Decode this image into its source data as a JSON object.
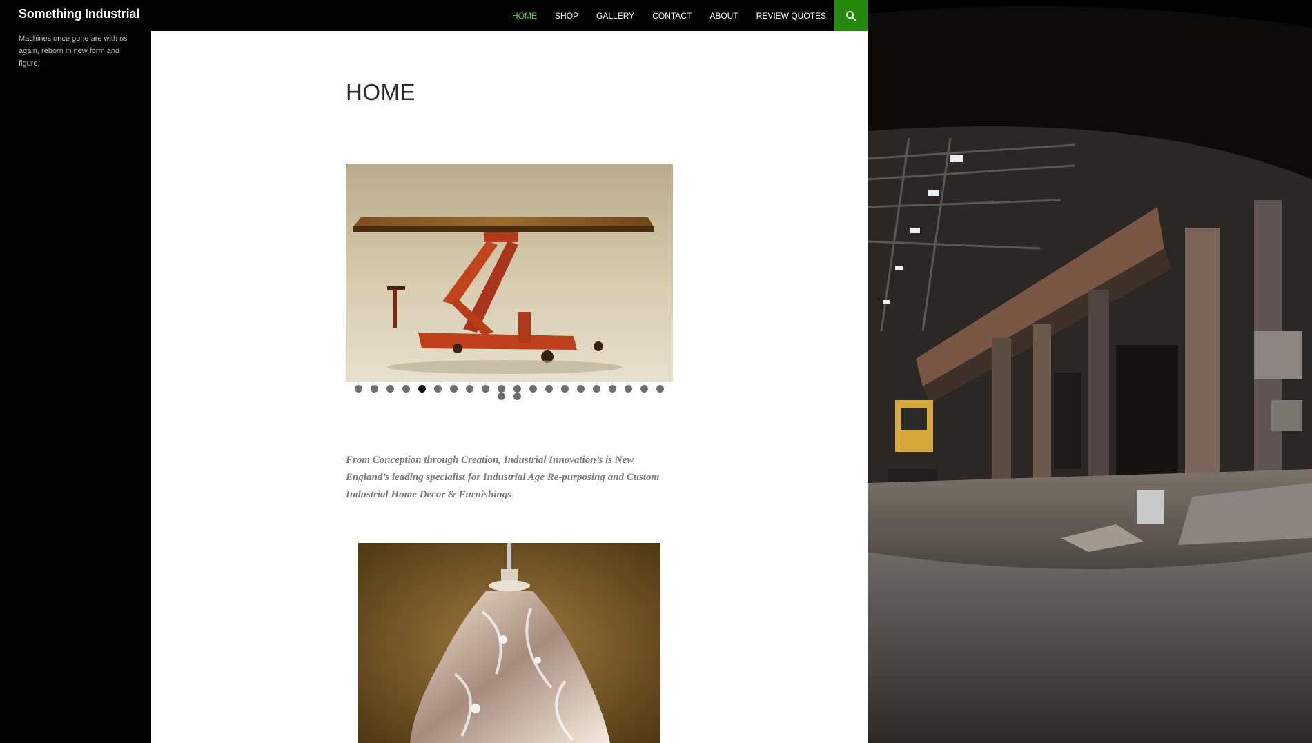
{
  "site": {
    "title": "Something Industrial",
    "description": "Machines once gone are with us again, reborn in new form and figure."
  },
  "nav": {
    "items": [
      {
        "label": "HOME",
        "current": true
      },
      {
        "label": "SHOP",
        "current": false
      },
      {
        "label": "GALLERY",
        "current": false
      },
      {
        "label": "CONTACT",
        "current": false
      },
      {
        "label": "ABOUT",
        "current": false
      },
      {
        "label": "REVIEW QUOTES",
        "current": false
      }
    ],
    "search_icon": "search-icon"
  },
  "page": {
    "title": "HOME",
    "tagline": "From Conception through Creation, Industrial Innovation’s is New England’s leading specialist for Industrial Age Re-purposing and Custom Industrial Home Decor & Furnishings"
  },
  "slider": {
    "total_slides": 22,
    "active_slide": 5,
    "image": "wood-top table on red industrial lift cart"
  },
  "images": {
    "second": "crystal glass pendant lamp",
    "background": "abandoned factory hall interior"
  },
  "colors": {
    "accent": "#24890d",
    "nav_current": "#55d737",
    "header_bg": "#000000",
    "content_bg": "#ffffff"
  }
}
